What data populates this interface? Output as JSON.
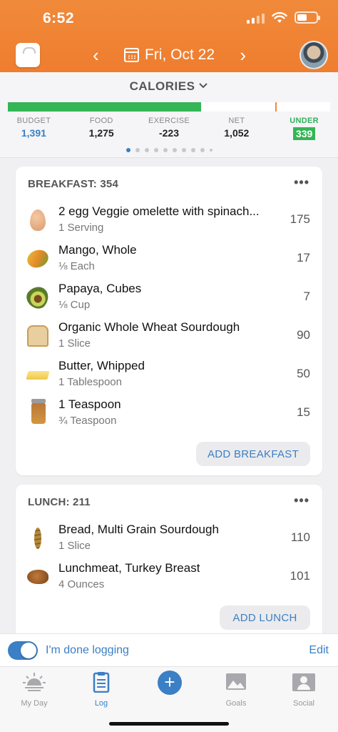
{
  "status": {
    "time": "6:52"
  },
  "header": {
    "date": "Fri, Oct 22"
  },
  "summary": {
    "title": "CALORIES",
    "progress_fraction": 0.6,
    "marker_fraction": 0.83,
    "stats": {
      "budget": {
        "label": "BUDGET",
        "value": "1,391"
      },
      "food": {
        "label": "FOOD",
        "value": "1,275"
      },
      "exercise": {
        "label": "EXERCISE",
        "value": "-223"
      },
      "net": {
        "label": "NET",
        "value": "1,052"
      },
      "under": {
        "label": "UNDER",
        "value": "339"
      }
    },
    "page_count": 10,
    "page_active": 0
  },
  "breakfast": {
    "title": "BREAKFAST: 354",
    "items": [
      {
        "icon": "egg-icon",
        "name": "2 egg Veggie omelette with spinach...",
        "serving": "1 Serving",
        "calories": "175"
      },
      {
        "icon": "mango-icon",
        "name": "Mango, Whole",
        "serving": "⅛ Each",
        "calories": "17"
      },
      {
        "icon": "papaya-icon",
        "name": "Papaya, Cubes",
        "serving": "⅛ Cup",
        "calories": "7"
      },
      {
        "icon": "bread-icon",
        "name": "Organic Whole Wheat Sourdough",
        "serving": "1 Slice",
        "calories": "90"
      },
      {
        "icon": "butter-icon",
        "name": "Butter, Whipped",
        "serving": "1 Tablespoon",
        "calories": "50"
      },
      {
        "icon": "jar-icon",
        "name": "1 Teaspoon",
        "serving": "¾ Teaspoon",
        "calories": "15"
      }
    ],
    "add_label": "ADD BREAKFAST"
  },
  "lunch": {
    "title": "LUNCH: 211",
    "items": [
      {
        "icon": "wheat-icon",
        "name": "Bread, Multi Grain Sourdough",
        "serving": "1 Slice",
        "calories": "110"
      },
      {
        "icon": "turkey-icon",
        "name": "Lunchmeat, Turkey Breast",
        "serving": "4 Ounces",
        "calories": "101"
      }
    ],
    "add_label": "ADD LUNCH"
  },
  "done_bar": {
    "label": "I'm done logging",
    "edit": "Edit",
    "toggle_on": true
  },
  "tabs": [
    {
      "label": "My Day",
      "icon": "sunrise-icon"
    },
    {
      "label": "Log",
      "icon": "clipboard-icon"
    },
    {
      "label": "",
      "icon": "plus-icon"
    },
    {
      "label": "Goals",
      "icon": "image-icon"
    },
    {
      "label": "Social",
      "icon": "people-icon"
    }
  ],
  "colors": {
    "header": "#ef7d2f",
    "accent": "#3b7fc4",
    "progress": "#34b556"
  }
}
